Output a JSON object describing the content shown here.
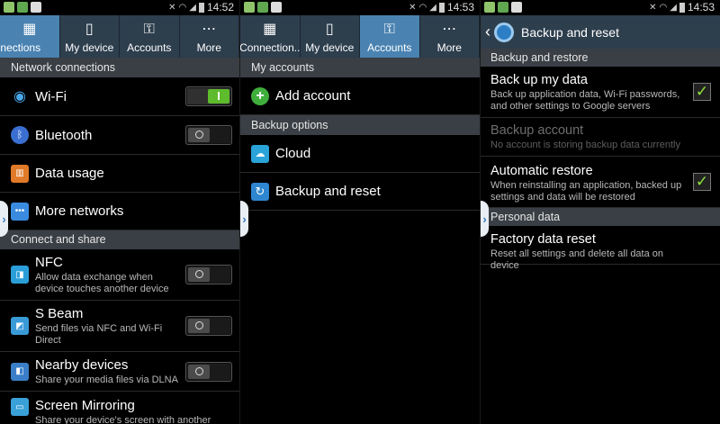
{
  "status_bar": {
    "panel1_time": "14:52",
    "panel2_time": "14:53",
    "panel3_time": "14:53"
  },
  "panel1": {
    "tabs": [
      {
        "label": "nections",
        "icon": "connections-icon"
      },
      {
        "label": "My device",
        "icon": "device-icon"
      },
      {
        "label": "Accounts",
        "icon": "key-icon"
      },
      {
        "label": "More",
        "icon": "more-icon"
      }
    ],
    "section_network": "Network connections",
    "wifi": "Wi-Fi",
    "bluetooth": "Bluetooth",
    "data_usage": "Data usage",
    "more_networks": "More networks",
    "section_connect": "Connect and share",
    "nfc_title": "NFC",
    "nfc_sub": "Allow data exchange when device touches another device",
    "sbeam_title": "S Beam",
    "sbeam_sub": "Send files via NFC and Wi-Fi Direct",
    "nearby_title": "Nearby devices",
    "nearby_sub": "Share your media files via DLNA",
    "mirror_title": "Screen Mirroring",
    "mirror_sub": "Share your device's screen with another"
  },
  "panel2": {
    "tabs": [
      {
        "label": "Connection..",
        "icon": "connections-icon"
      },
      {
        "label": "My device",
        "icon": "device-icon"
      },
      {
        "label": "Accounts",
        "icon": "key-icon"
      },
      {
        "label": "More",
        "icon": "more-icon"
      }
    ],
    "section_accounts": "My accounts",
    "add_account": "Add account",
    "section_backup": "Backup options",
    "cloud": "Cloud",
    "backup_reset": "Backup and reset"
  },
  "panel3": {
    "header_title": "Backup and reset",
    "section_backup": "Backup and restore",
    "backup_data_title": "Back up my data",
    "backup_data_sub": "Back up application data, Wi-Fi passwords, and other settings to Google servers",
    "backup_account_title": "Backup account",
    "backup_account_sub": "No account is storing backup data currently",
    "auto_restore_title": "Automatic restore",
    "auto_restore_sub": "When reinstalling an application, backed up settings and data will be restored",
    "section_personal": "Personal data",
    "factory_title": "Factory data reset",
    "factory_sub": "Reset all settings and delete all data on device"
  },
  "colors": {
    "tab_bar": "#2d3e4d",
    "tab_active": "#4a83b2",
    "section_header": "#3a3f45",
    "toggle_on": "#5dbb2c",
    "check_green": "#8ee63f"
  }
}
